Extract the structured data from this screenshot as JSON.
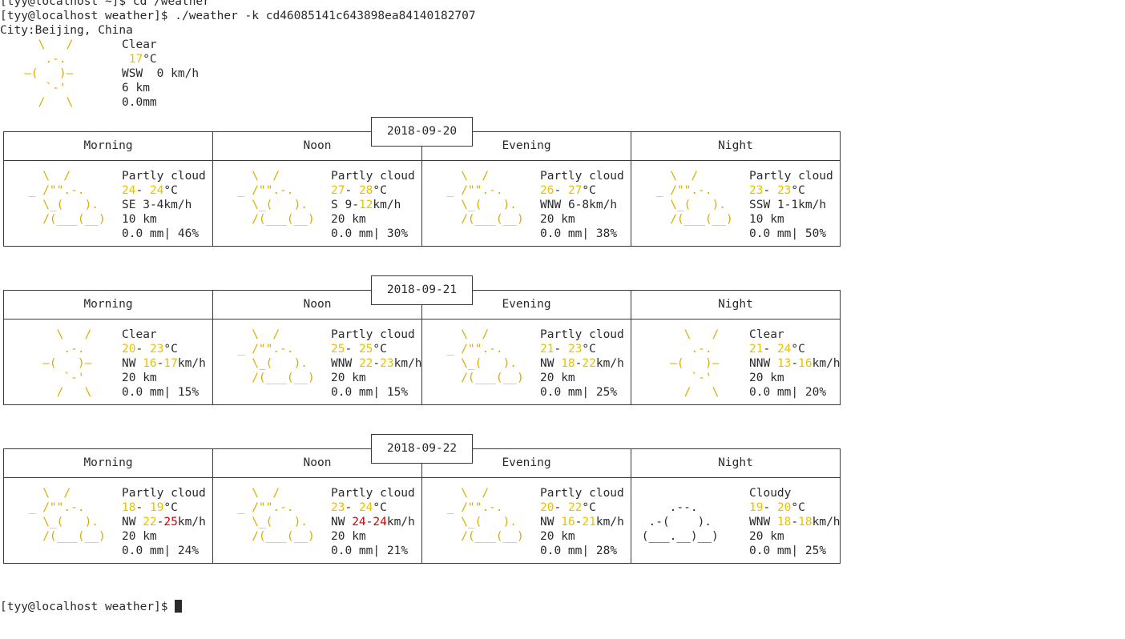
{
  "terminal": {
    "prev_prompt": "[tyy@localhost ~]$ cd /weather",
    "command_prompt": "[tyy@localhost weather]$ ./weather -k cd46085141c643898ea84140182707",
    "final_prompt": "[tyy@localhost weather]$ "
  },
  "current": {
    "city_label": "City:",
    "city": "Beijing, China",
    "condition": "Clear",
    "temp": "17",
    "temp_unit": "°C",
    "wind_dir": "WSW",
    "wind_speed": "0",
    "wind_unit": "km/h",
    "visibility": "6 km",
    "precip": "0.0mm",
    "icon": "sun-icon"
  },
  "period_names": [
    "Morning",
    "Noon",
    "Evening",
    "Night"
  ],
  "forecast": [
    {
      "date": "2018-09-20",
      "periods": [
        {
          "condition": "Partly cloud",
          "icon": "partly-cloudy-icon",
          "t1": "24",
          "t2": "24",
          "wind_dir": "SE",
          "w1": "3",
          "w2": "4",
          "vis": "10 km",
          "precip": "0.0 mm",
          "chance": "46%"
        },
        {
          "condition": "Partly cloud",
          "icon": "partly-cloudy-icon",
          "t1": "27",
          "t2": "28",
          "wind_dir": "S",
          "w1": "9",
          "w2": "12",
          "vis": "20 km",
          "precip": "0.0 mm",
          "chance": "30%"
        },
        {
          "condition": "Partly cloud",
          "icon": "partly-cloudy-icon",
          "t1": "26",
          "t2": "27",
          "wind_dir": "WNW",
          "w1": "6",
          "w2": "8",
          "vis": "20 km",
          "precip": "0.0 mm",
          "chance": "38%"
        },
        {
          "condition": "Partly cloud",
          "icon": "partly-cloudy-icon",
          "t1": "23",
          "t2": "23",
          "wind_dir": "SSW",
          "w1": "1",
          "w2": "1",
          "vis": "10 km",
          "precip": "0.0 mm",
          "chance": "50%"
        }
      ]
    },
    {
      "date": "2018-09-21",
      "periods": [
        {
          "condition": "Clear",
          "icon": "sun-icon",
          "t1": "20",
          "t2": "23",
          "wind_dir": "NW",
          "w1": "16",
          "w2": "17",
          "vis": "20 km",
          "precip": "0.0 mm",
          "chance": "15%"
        },
        {
          "condition": "Partly cloud",
          "icon": "partly-cloudy-icon",
          "t1": "25",
          "t2": "25",
          "wind_dir": "WNW",
          "w1": "22",
          "w2": "23",
          "vis": "20 km",
          "precip": "0.0 mm",
          "chance": "15%"
        },
        {
          "condition": "Partly cloud",
          "icon": "partly-cloudy-icon",
          "t1": "21",
          "t2": "23",
          "wind_dir": "NW",
          "w1": "18",
          "w2": "22",
          "vis": "20 km",
          "precip": "0.0 mm",
          "chance": "25%"
        },
        {
          "condition": "Clear",
          "icon": "sun-icon",
          "t1": "21",
          "t2": "24",
          "wind_dir": "NNW",
          "w1": "13",
          "w2": "16",
          "vis": "20 km",
          "precip": "0.0 mm",
          "chance": "20%"
        }
      ]
    },
    {
      "date": "2018-09-22",
      "periods": [
        {
          "condition": "Partly cloud",
          "icon": "partly-cloudy-icon",
          "t1": "18",
          "t2": "19",
          "wind_dir": "NW",
          "w1": "22",
          "w2": "25",
          "vis": "20 km",
          "precip": "0.0 mm",
          "chance": "24%"
        },
        {
          "condition": "Partly cloud",
          "icon": "partly-cloudy-icon",
          "t1": "23",
          "t2": "24",
          "wind_dir": "NW",
          "w1": "24",
          "w2": "24",
          "vis": "20 km",
          "precip": "0.0 mm",
          "chance": "21%"
        },
        {
          "condition": "Partly cloud",
          "icon": "partly-cloudy-icon",
          "t1": "20",
          "t2": "22",
          "wind_dir": "NW",
          "w1": "16",
          "w2": "21",
          "vis": "20 km",
          "precip": "0.0 mm",
          "chance": "28%"
        },
        {
          "condition": "Cloudy",
          "icon": "cloud-icon",
          "t1": "19",
          "t2": "20",
          "wind_dir": "WNW",
          "w1": "18",
          "w2": "18",
          "vis": "20 km",
          "precip": "0.0 mm",
          "chance": "25%"
        }
      ]
    }
  ],
  "colors": {
    "text": "#2a2a2a",
    "art_yellow": "#d9ad00",
    "value_yellow": "#e8c200",
    "value_red": "#d80000",
    "border": "#3a3a3a"
  }
}
